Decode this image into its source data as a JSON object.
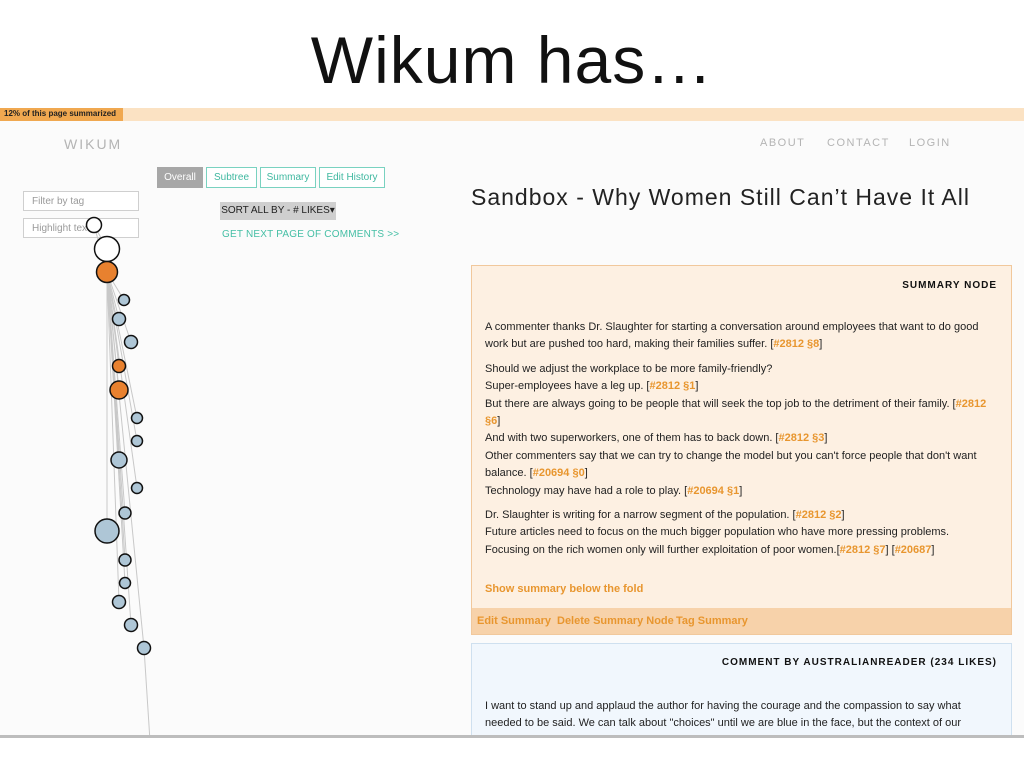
{
  "slide": {
    "title": "Wikum has…"
  },
  "progress": {
    "label": "12% of this page summarized",
    "fraction": 0.12
  },
  "header": {
    "logo": "WIKUM",
    "nav": [
      "ABOUT",
      "CONTACT",
      "LOGIN"
    ]
  },
  "filters": {
    "tag_placeholder": "Filter by tag",
    "highlight_placeholder": "Highlight text"
  },
  "tabs": [
    {
      "label": "Overall",
      "active": true
    },
    {
      "label": "Subtree",
      "active": false
    },
    {
      "label": "Summary",
      "active": false
    },
    {
      "label": "Edit History",
      "active": false
    }
  ],
  "sort": {
    "label": "SORT ALL BY - # LIKES▾"
  },
  "next_page": {
    "label": "GET NEXT PAGE OF COMMENTS >>"
  },
  "tree": {
    "colors": {
      "root": "#ffffff",
      "summary": "#e8812f",
      "comment": "#aec6d6",
      "stroke": "#111111",
      "edge": "#c8c8c8"
    },
    "nodes": [
      "root",
      "summary",
      "comment",
      "comment",
      "comment",
      "summary",
      "summary",
      "comment",
      "comment",
      "comment",
      "comment",
      "comment",
      "comment",
      "comment",
      "comment",
      "comment",
      "comment",
      "comment"
    ]
  },
  "page": {
    "title": "Sandbox - Why Women Still Can’t Have It All"
  },
  "summary_node": {
    "heading": "SUMMARY NODE",
    "paragraphs": [
      [
        {
          "text": "A commenter thanks Dr. Slaughter for starting a conversation around employees that want to do good work but are pushed too hard, making their families suffer. ["
        },
        {
          "text": "#2812 §8",
          "ref": true
        },
        {
          "text": "]"
        }
      ],
      [
        {
          "text": "Should we adjust the workplace to be more family-friendly?"
        },
        {
          "br": true
        },
        {
          "text": "Super-employees have a leg up. ["
        },
        {
          "text": "#2812 §1",
          "ref": true
        },
        {
          "text": "]"
        },
        {
          "br": true
        },
        {
          "text": "But there are always going to be people that will seek the top job to the detriment of their family. ["
        },
        {
          "text": "#2812 §6",
          "ref": true
        },
        {
          "text": "]"
        },
        {
          "br": true
        },
        {
          "text": "And with two superworkers, one of them has to back down. ["
        },
        {
          "text": "#2812 §3",
          "ref": true
        },
        {
          "text": "]"
        },
        {
          "br": true
        },
        {
          "text": "Other commenters say that we can try to change the model but you can't force people that don't want balance. ["
        },
        {
          "text": "#20694 §0",
          "ref": true
        },
        {
          "text": "]"
        },
        {
          "br": true
        },
        {
          "text": "Technology may have had a role to play. ["
        },
        {
          "text": "#20694 §1",
          "ref": true
        },
        {
          "text": "]"
        }
      ],
      [
        {
          "text": "Dr. Slaughter is writing for a narrow segment of the population. ["
        },
        {
          "text": "#2812 §2",
          "ref": true
        },
        {
          "text": "]"
        },
        {
          "br": true
        },
        {
          "text": "Future articles need to focus on the much bigger population who have more pressing problems."
        },
        {
          "br": true
        },
        {
          "text": "Focusing on the rich women only will further exploitation of poor women.["
        },
        {
          "text": "#2812 §7",
          "ref": true
        },
        {
          "text": "] ["
        },
        {
          "text": "#20687",
          "ref": true
        },
        {
          "text": "]"
        }
      ]
    ],
    "show_more": "Show summary below the fold",
    "actions": [
      "Edit Summary",
      "Delete Summary Node",
      "Tag Summary"
    ]
  },
  "comment": {
    "heading": "COMMENT BY AUSTRALIANREADER (234 LIKES)",
    "text": "I want to stand up and applaud the author for having the courage and the compassion to say what needed to be said. We can talk about \"choices\" until we are blue in the face, but the context of our"
  }
}
